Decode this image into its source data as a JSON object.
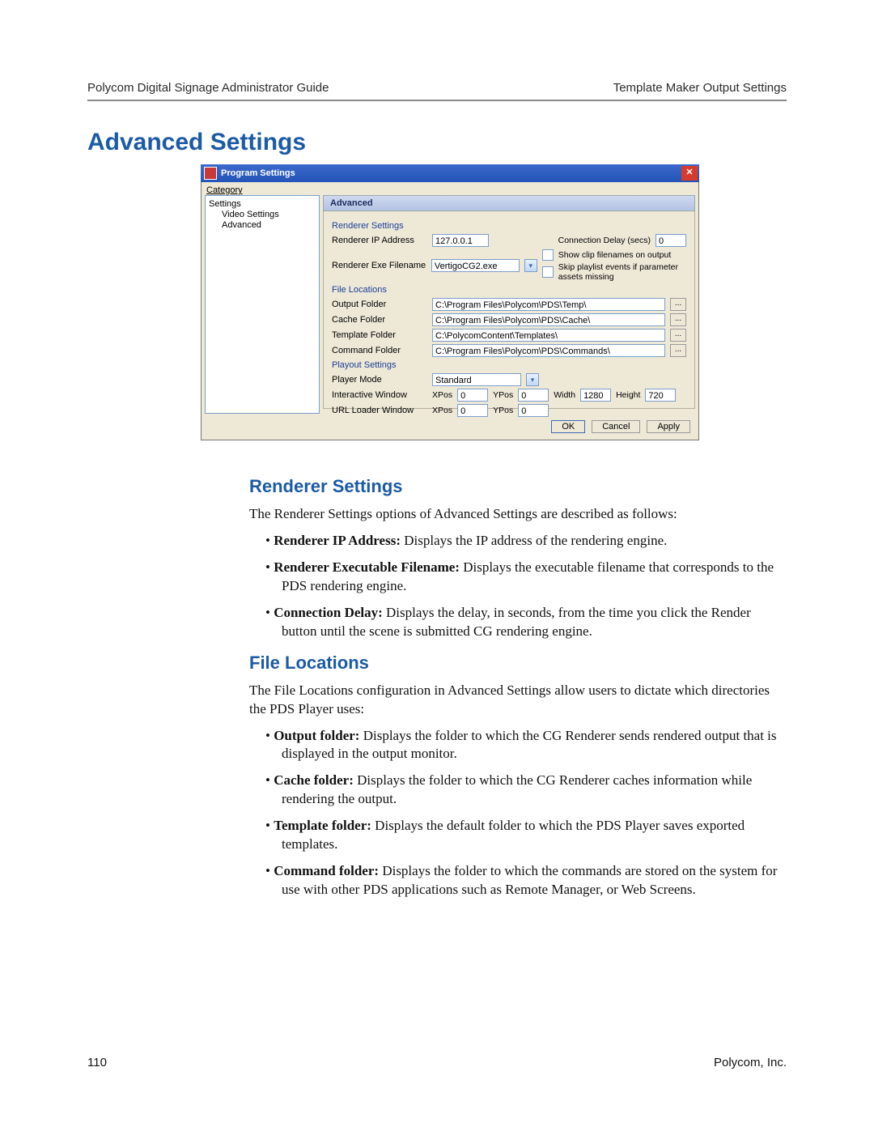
{
  "header": {
    "left": "Polycom Digital Signage Administrator Guide",
    "right": "Template Maker Output Settings"
  },
  "title": "Advanced Settings",
  "dialog": {
    "title": "Program Settings",
    "categoryLabel": "Category",
    "tree": {
      "root": "Settings",
      "child1": "Video Settings",
      "child2": "Advanced"
    },
    "panelTitle": "Advanced",
    "renderer": {
      "groupTitle": "Renderer Settings",
      "ipLabel": "Renderer IP Address",
      "ipValue": "127.0.0.1",
      "connDelayLabel": "Connection Delay (secs)",
      "connDelayValue": "0",
      "exeLabel": "Renderer Exe Filename",
      "exeValue": "VertigoCG2.exe",
      "chkShowClip": "Show clip filenames on output",
      "chkSkip": "Skip playlist events if parameter assets missing"
    },
    "fileLoc": {
      "groupTitle": "File Locations",
      "outputLabel": "Output Folder",
      "outputValue": "C:\\Program Files\\Polycom\\PDS\\Temp\\",
      "cacheLabel": "Cache Folder",
      "cacheValue": "C:\\Program Files\\Polycom\\PDS\\Cache\\",
      "templateLabel": "Template Folder",
      "templateValue": "C:\\PolycomContent\\Templates\\",
      "commandLabel": "Command Folder",
      "commandValue": "C:\\Program Files\\Polycom\\PDS\\Commands\\"
    },
    "playout": {
      "groupTitle": "Playout Settings",
      "playerModeLabel": "Player Mode",
      "playerModeValue": "Standard",
      "interactiveLabel": "Interactive Window",
      "urlLabel": "URL Loader Window",
      "xposLabel": "XPos",
      "xposVal": "0",
      "yposLabel": "YPos",
      "yposVal": "0",
      "widthLabel": "Width",
      "widthVal": "1280",
      "heightLabel": "Height",
      "heightVal": "720",
      "xpos2": "0",
      "ypos2": "0"
    },
    "buttons": {
      "ok": "OK",
      "cancel": "Cancel",
      "apply": "Apply"
    }
  },
  "sections": {
    "renderer": {
      "heading": "Renderer Settings",
      "intro": "The Renderer Settings options of Advanced Settings are described as follows:",
      "b1_bold": "Renderer IP Address:",
      "b1_rest": " Displays the IP address of the rendering engine.",
      "b2_bold": "Renderer Executable Filename:",
      "b2_rest": " Displays the executable filename that corresponds to the PDS rendering engine.",
      "b3_bold": "Connection Delay:",
      "b3_rest": " Displays the delay, in seconds, from the time you click the Render button until the scene is submitted CG rendering engine."
    },
    "fileloc": {
      "heading": "File Locations",
      "intro": "The File Locations configuration in Advanced Settings allow users to dictate which directories the PDS Player uses:",
      "b1_bold": "Output folder:",
      "b1_rest": " Displays the folder to which the CG Renderer sends rendered output that is displayed in the output monitor.",
      "b2_bold": "Cache folder:",
      "b2_rest": " Displays the folder to which the CG Renderer caches information while rendering the output.",
      "b3_bold": "Template folder:",
      "b3_rest": " Displays the default folder to which the PDS Player saves exported templates.",
      "b4_bold": "Command folder:",
      "b4_rest": " Displays the folder to which the commands are stored on the system for use with other PDS applications such as Remote Manager, or Web Screens."
    }
  },
  "footer": {
    "page": "110",
    "company": "Polycom, Inc."
  }
}
